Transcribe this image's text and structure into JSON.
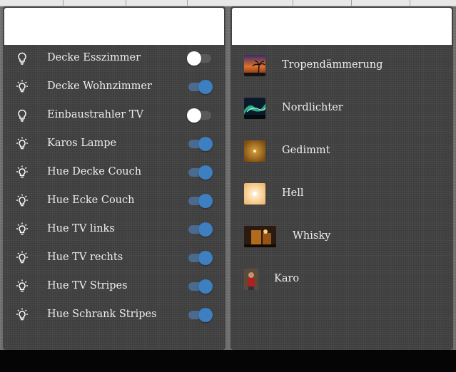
{
  "lights": {
    "items": [
      {
        "label": "Decke Esszimmer",
        "icon": "bulb-off-icon",
        "on": false
      },
      {
        "label": "Decke Wohnzimmer",
        "icon": "bulb-on-icon",
        "on": true
      },
      {
        "label": "Einbaustrahler TV",
        "icon": "bulb-off-icon",
        "on": false
      },
      {
        "label": "Karos Lampe",
        "icon": "bulb-on-icon",
        "on": true
      },
      {
        "label": "Hue Decke Couch",
        "icon": "bulb-on-icon",
        "on": true
      },
      {
        "label": "Hue Ecke Couch",
        "icon": "bulb-on-icon",
        "on": true
      },
      {
        "label": "Hue TV links",
        "icon": "bulb-on-icon",
        "on": true
      },
      {
        "label": "Hue TV rechts",
        "icon": "bulb-on-icon",
        "on": true
      },
      {
        "label": "Hue TV Stripes",
        "icon": "bulb-on-icon",
        "on": true
      },
      {
        "label": "Hue Schrank Stripes",
        "icon": "bulb-on-icon",
        "on": true
      }
    ]
  },
  "scenes": {
    "items": [
      {
        "label": "Tropendämmerung",
        "thumb": "sunset-palm-thumbnail"
      },
      {
        "label": "Nordlichter",
        "thumb": "aurora-thumbnail"
      },
      {
        "label": "Gedimmt",
        "thumb": "dimmed-thumbnail"
      },
      {
        "label": "Hell",
        "thumb": "bright-thumbnail"
      },
      {
        "label": "Whisky",
        "thumb": "whisky-thumbnail"
      },
      {
        "label": "Karo",
        "thumb": "portrait-thumbnail"
      }
    ]
  },
  "colors": {
    "toggle_on": "#3d7fc0",
    "toggle_off_knob": "#ffffff",
    "panel_bg": "#3e3e3e"
  }
}
